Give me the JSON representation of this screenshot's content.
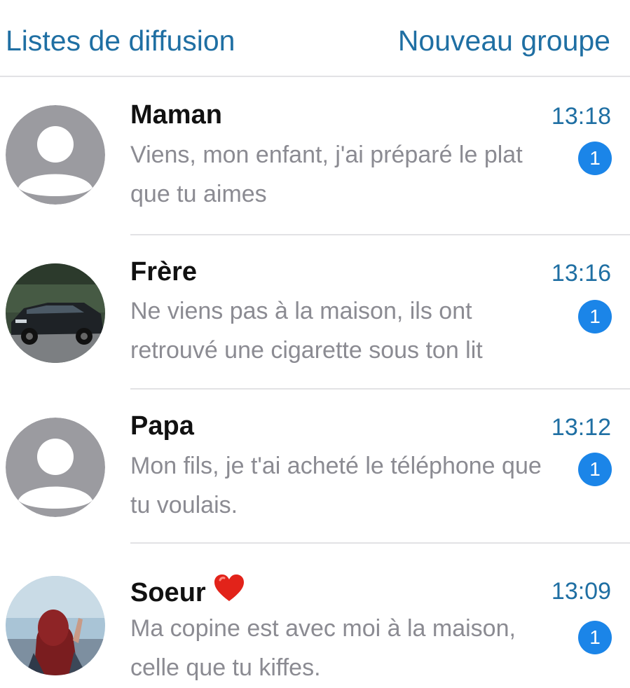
{
  "header": {
    "left_label": "Listes de diffusion",
    "right_label": "Nouveau groupe"
  },
  "chats": [
    {
      "name": "Maman",
      "time": "13:18",
      "preview": "Viens, mon enfant, j'ai préparé le plat que tu aimes",
      "unread": "1",
      "avatar": "default-avatar-icon"
    },
    {
      "name": "Frère",
      "time": "13:16",
      "preview": "Ne viens pas à la maison, ils ont retrouvé une cigarette sous ton lit",
      "unread": "1",
      "avatar": "car-photo"
    },
    {
      "name": "Papa",
      "time": "13:12",
      "preview": "Mon fils, je t'ai acheté le téléphone que tu voulais.",
      "unread": "1",
      "avatar": "default-avatar-icon"
    },
    {
      "name": "Soeur",
      "name_emoji": "red-heart-icon",
      "time": "13:09",
      "preview": "Ma copine est avec moi à la maison, celle que tu kiffes.",
      "unread": "1",
      "avatar": "hijab-person-photo"
    }
  ],
  "colors": {
    "accent": "#1f6fa3",
    "badge": "#1b85e8",
    "preview_text": "#8b8b92",
    "divider": "#e2e2e5",
    "default_avatar_bg": "#9b9ba0"
  }
}
